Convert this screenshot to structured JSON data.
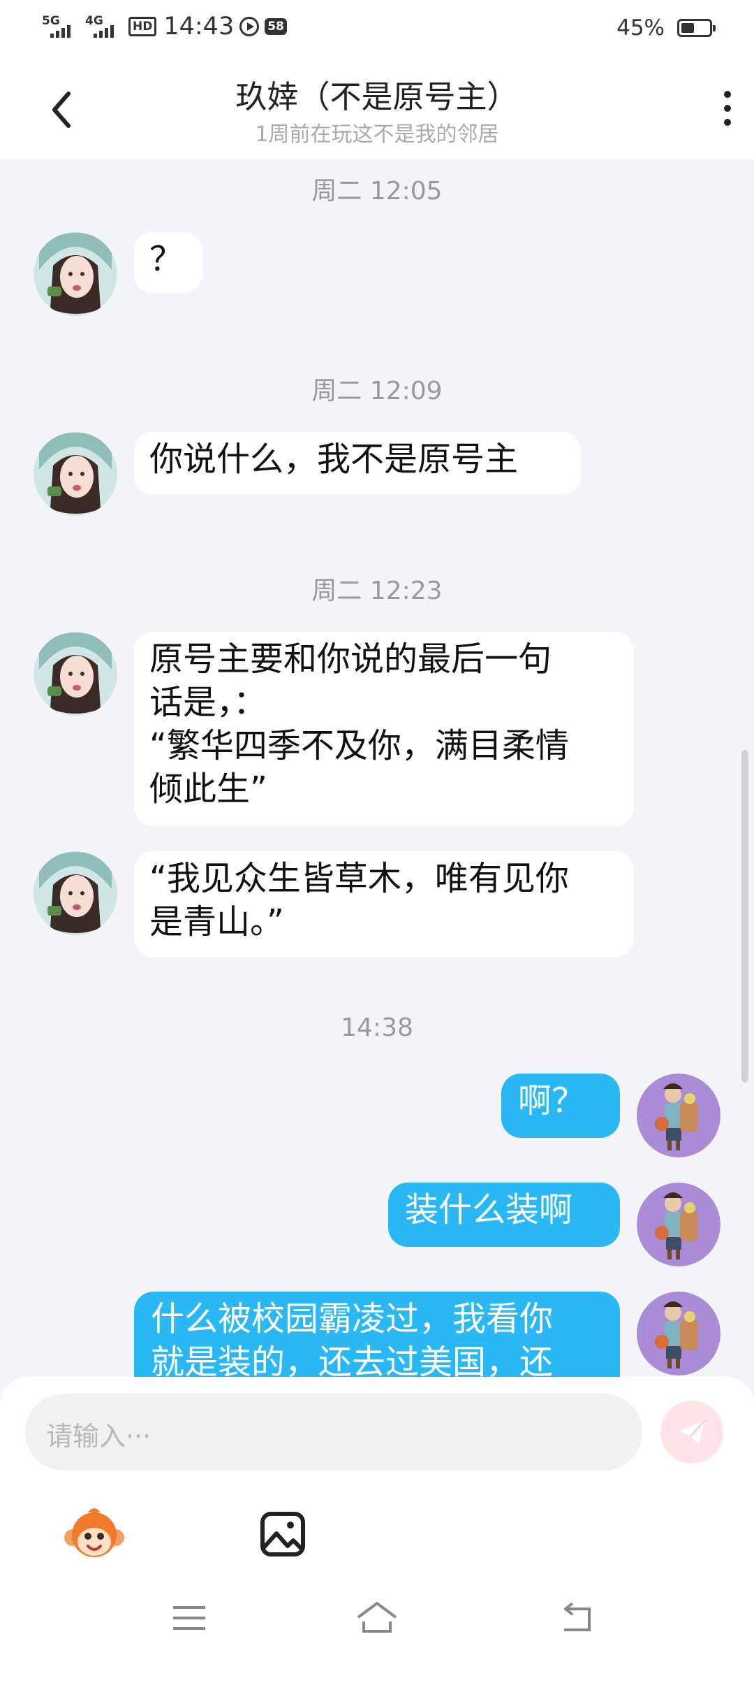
{
  "status_bar": {
    "network1": "5G",
    "network2": "4G",
    "hd_label": "HD",
    "time": "14:43",
    "notification_count": "58",
    "battery_percent": "45%"
  },
  "header": {
    "title": "玖婞（不是原号主）",
    "subtitle": "1周前在玩这不是我的邻居"
  },
  "messages": [
    {
      "type": "time",
      "text": "周二 12:05"
    },
    {
      "type": "in",
      "text": "？"
    },
    {
      "type": "time",
      "text": "周二 12:09"
    },
    {
      "type": "in",
      "text": "你说什么，我不是原号主"
    },
    {
      "type": "time",
      "text": "周二 12:23"
    },
    {
      "type": "in",
      "text": "原号主要和你说的最后一句\n话是，：\n“繁华四季不及你，满目柔情\n倾此生”"
    },
    {
      "type": "in",
      "text": "“我见众生皆草木，唯有见你\n是青山。”"
    },
    {
      "type": "time",
      "text": "14:38"
    },
    {
      "type": "out",
      "text": "啊？"
    },
    {
      "type": "out",
      "text": "装什么装啊"
    },
    {
      "type": "out",
      "text": "什么被校园霸凌过，我看你\n就是装的，还去过美国，还"
    }
  ],
  "input": {
    "placeholder": "请输入···"
  },
  "icons": {
    "back": "chevron-left-icon",
    "more": "more-vertical-icon",
    "send": "send-icon",
    "sticker": "monkey-sticker-icon",
    "image": "image-icon",
    "nav_menu": "menu-icon",
    "nav_home": "home-icon",
    "nav_back": "back-icon"
  },
  "colors": {
    "outgoing_bubble": "#29b8f4",
    "incoming_bubble": "#ffffff",
    "background": "#f2f4f7"
  }
}
